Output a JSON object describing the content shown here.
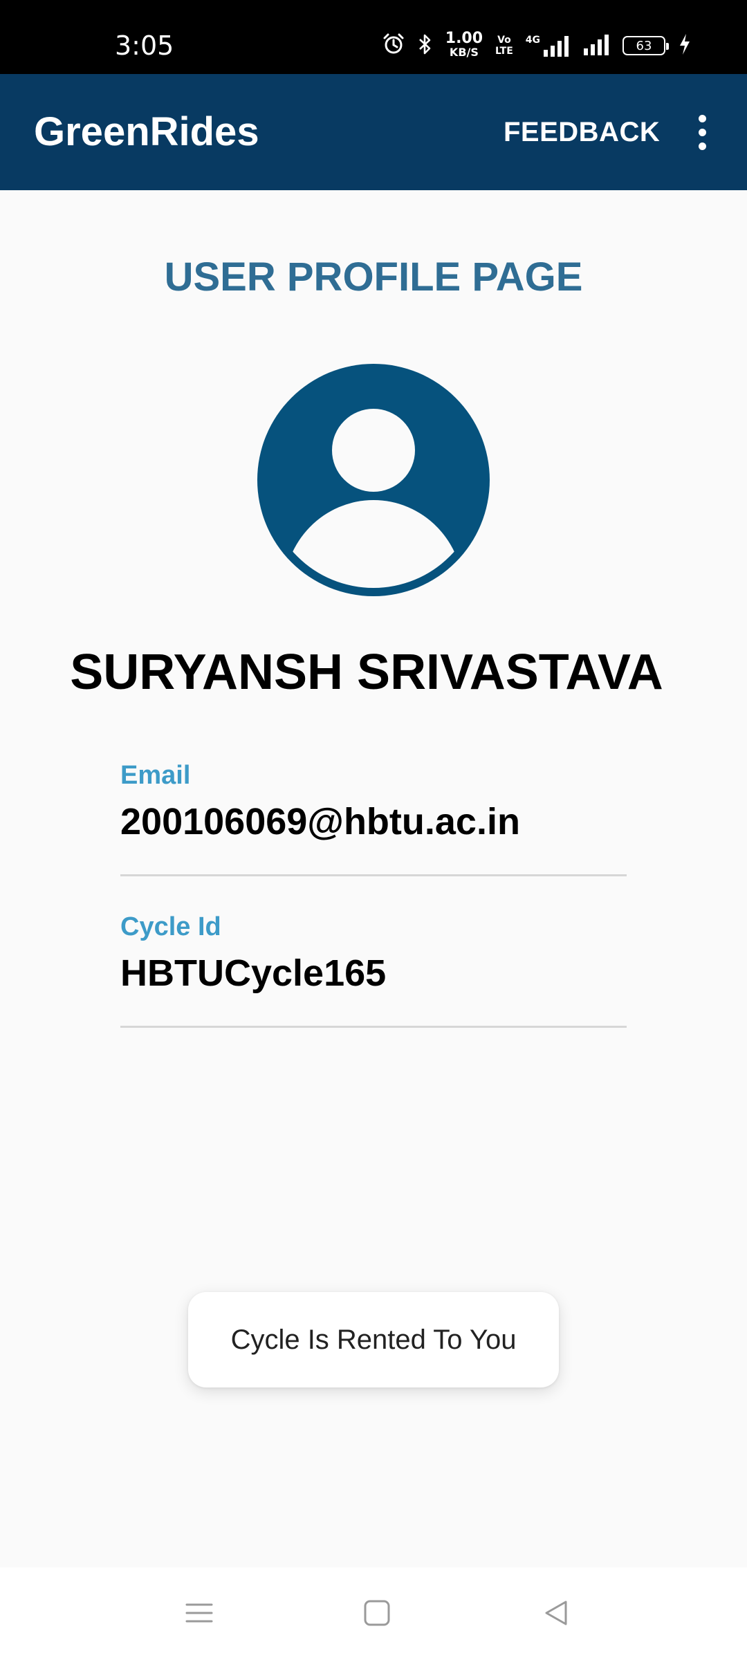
{
  "status_bar": {
    "time": "3:05",
    "net_speed_value": "1.00",
    "net_speed_unit": "KB/S",
    "volte_top": "Vo",
    "volte_bottom": "LTE",
    "network_type": "4G",
    "battery_level": "63"
  },
  "app_bar": {
    "title": "GreenRides",
    "feedback_label": "FEEDBACK"
  },
  "profile": {
    "heading": "USER PROFILE PAGE",
    "name": "SURYANSH SRIVASTAVA",
    "email_label": "Email",
    "email_value": "200106069@hbtu.ac.in",
    "cycle_label": "Cycle Id",
    "cycle_value": "HBTUCycle165"
  },
  "toast": {
    "message": "Cycle Is Rented To You"
  },
  "colors": {
    "app_bar": "#083a62",
    "heading": "#2f6d94",
    "avatar": "#06527d",
    "field_label": "#3d9bc8"
  },
  "icons": {
    "alarm": "alarm-icon",
    "bluetooth": "bluetooth-icon",
    "signal": "signal-icon",
    "battery": "battery-icon",
    "charging": "charging-icon",
    "overflow": "more-vert-icon",
    "avatar": "account-circle-icon",
    "nav_menu": "recent-apps-icon",
    "nav_home": "home-icon",
    "nav_back": "back-icon"
  }
}
